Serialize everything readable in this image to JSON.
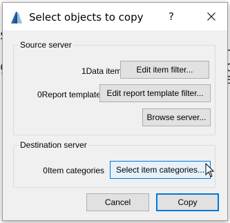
{
  "window": {
    "title": "Select objects to copy",
    "help_glyph": "?",
    "icon": "app-logo-icon"
  },
  "source": {
    "group_label": "Source server",
    "data_items_label": "1Data items",
    "edit_item_filter_button": "Edit item filter...",
    "report_templates_label": "0Report templates",
    "edit_report_template_filter_button": "Edit report template filter...",
    "browse_server_button": "Browse server..."
  },
  "destination": {
    "group_label": "Destination server",
    "item_categories_label": "0Item categories",
    "select_item_categories_button": "Select item categories..."
  },
  "footer": {
    "cancel_button": "Cancel",
    "copy_button": "Copy"
  },
  "colors": {
    "accent": "#0078d7",
    "dialog_bg": "#f0f0f0",
    "button_bg": "#e1e1e1"
  }
}
